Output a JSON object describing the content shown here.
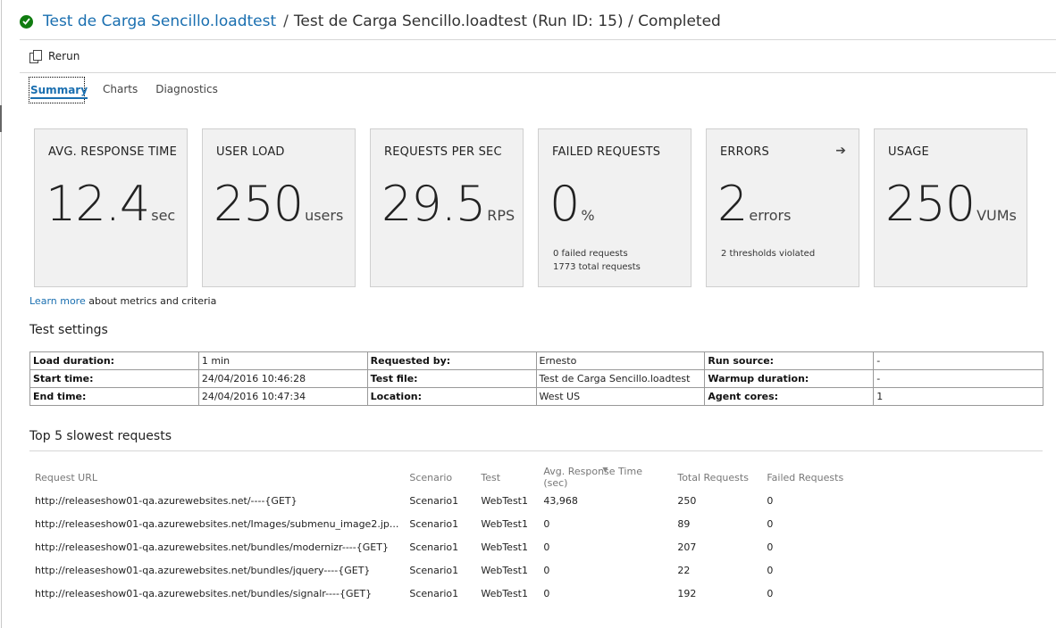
{
  "header": {
    "link_title": "Test de Carga Sencillo.loadtest",
    "separator": "/",
    "rest_title": "Test de Carga Sencillo.loadtest (Run ID: 15) / Completed"
  },
  "toolbar": {
    "rerun_label": "Rerun"
  },
  "tabs": [
    {
      "label": "Summary",
      "active": true
    },
    {
      "label": "Charts"
    },
    {
      "label": "Diagnostics"
    }
  ],
  "cards": [
    {
      "title": "AVG. RESPONSE TIME",
      "value": "12.4",
      "unit": "sec",
      "note1": "",
      "note2": ""
    },
    {
      "title": "USER LOAD",
      "value": "250",
      "unit": "users",
      "note1": "",
      "note2": ""
    },
    {
      "title": "REQUESTS PER SEC",
      "value": "29.5",
      "unit": "RPS",
      "note1": "",
      "note2": ""
    },
    {
      "title": "FAILED REQUESTS",
      "value": "0",
      "unit": "%",
      "note1": "0 failed requests",
      "note2": "1773 total requests"
    },
    {
      "title": "ERRORS",
      "value": "2",
      "unit": "errors",
      "note1": "2 thresholds violated",
      "note2": ""
    },
    {
      "title": "USAGE",
      "value": "250",
      "unit": "VUMs",
      "note1": "",
      "note2": ""
    }
  ],
  "errors_arrow": "➔",
  "learn": {
    "link": "Learn more",
    "text": " about metrics and criteria"
  },
  "settings": {
    "title": "Test settings",
    "rows": [
      [
        "Load duration:",
        "1 min",
        "Requested by:",
        "Ernesto",
        "Run source:",
        "-"
      ],
      [
        "Start time:",
        "24/04/2016 10:46:28",
        "Test file:",
        "Test de Carga Sencillo.loadtest",
        "Warmup duration:",
        "-"
      ],
      [
        "End time:",
        "24/04/2016 10:47:34",
        "Location:",
        "West US",
        "Agent cores:",
        "1"
      ]
    ]
  },
  "slowest": {
    "title": "Top 5 slowest requests",
    "sort_indicator": "▼",
    "columns": [
      "Request URL",
      "Scenario",
      "Test",
      "Avg. Response Time (sec)",
      "Total Requests",
      "Failed Requests"
    ],
    "rows": [
      [
        "http://releaseshow01-qa.azurewebsites.net/----{GET}",
        "Scenario1",
        "WebTest1",
        "43,968",
        "250",
        "0"
      ],
      [
        "http://releaseshow01-qa.azurewebsites.net/Images/submenu_image2.jp...",
        "Scenario1",
        "WebTest1",
        "0",
        "89",
        "0"
      ],
      [
        "http://releaseshow01-qa.azurewebsites.net/bundles/modernizr----{GET}",
        "Scenario1",
        "WebTest1",
        "0",
        "207",
        "0"
      ],
      [
        "http://releaseshow01-qa.azurewebsites.net/bundles/jquery----{GET}",
        "Scenario1",
        "WebTest1",
        "0",
        "22",
        "0"
      ],
      [
        "http://releaseshow01-qa.azurewebsites.net/bundles/signalr----{GET}",
        "Scenario1",
        "WebTest1",
        "0",
        "192",
        "0"
      ]
    ]
  }
}
